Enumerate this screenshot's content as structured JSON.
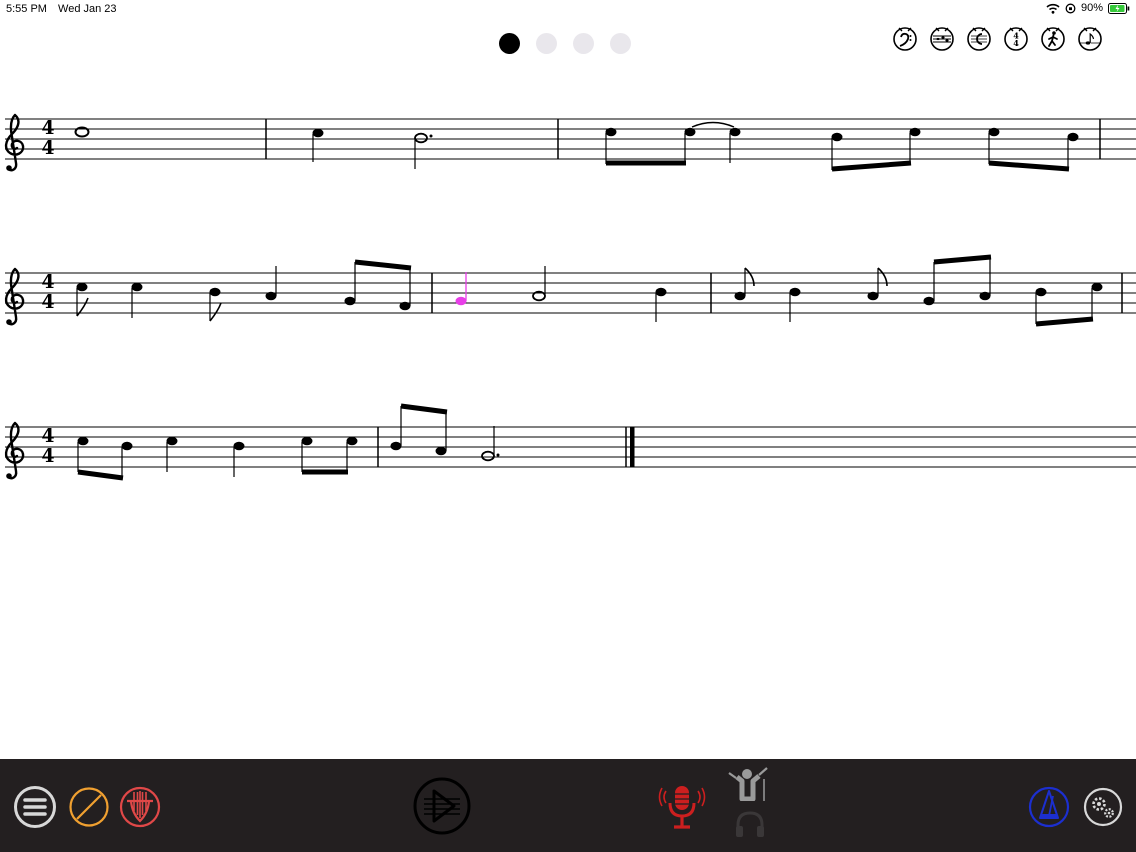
{
  "status": {
    "time": "5:55 PM",
    "date": "Wed Jan 23",
    "battery": "90%"
  },
  "pages": {
    "count": 4,
    "active": 0
  },
  "top_tools": [
    {
      "name": "bass-clef-tool-icon"
    },
    {
      "name": "staff-tool-icon"
    },
    {
      "name": "treble-clef-tool-icon"
    },
    {
      "name": "time-signature-tool-icon"
    },
    {
      "name": "walking-tempo-tool-icon"
    },
    {
      "name": "note-tool-icon"
    }
  ],
  "score": {
    "time_signature": {
      "top": "4",
      "bottom": "4"
    },
    "highlight_color": "#e83ee8",
    "systems": 3
  },
  "bottom": {
    "menu_color": "#d8d8d8",
    "pencil_color": "#f0a030",
    "instrument_color": "#e04848",
    "mic_color": "#cc1f1f",
    "conductor_color": "#9a9a9a",
    "tuner_color": "#1c2fd0",
    "settings_color": "#d8d8d8"
  }
}
